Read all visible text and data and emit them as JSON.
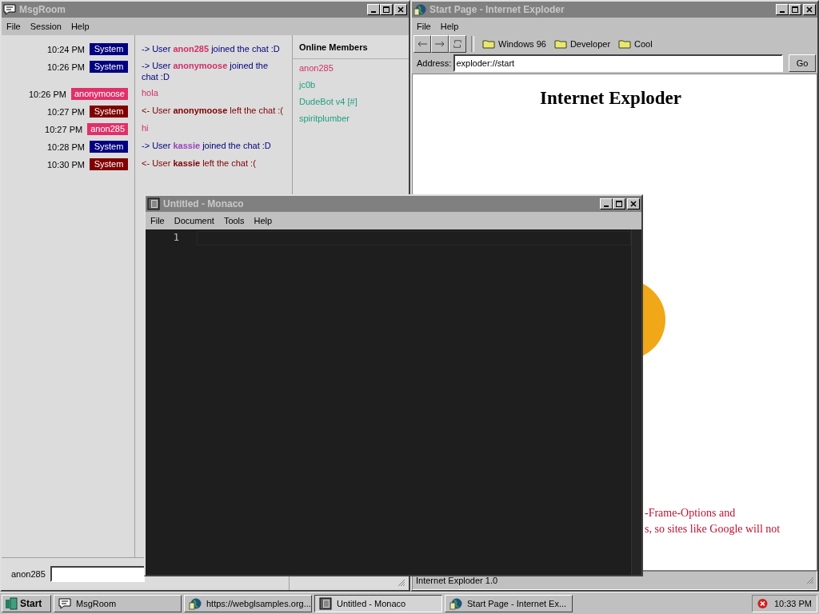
{
  "msgroom": {
    "title": "MsgRoom",
    "menu": [
      "File",
      "Session",
      "Help"
    ],
    "messages": [
      {
        "time": "10:24 PM",
        "sender": "System",
        "kind": "join",
        "before": "-> User ",
        "user": "anon285",
        "color": "#d0306a",
        "after": " joined the chat :D"
      },
      {
        "time": "10:26 PM",
        "sender": "System",
        "kind": "join",
        "before": "-> User ",
        "user": "anonymoose",
        "color": "#d0306a",
        "after": " joined the chat :D"
      },
      {
        "time": "10:26 PM",
        "sender": "anonymoose",
        "kind": "chat",
        "before": "hola"
      },
      {
        "time": "10:27 PM",
        "sender": "System",
        "kind": "leave",
        "before": "<- User ",
        "user": "anonymoose",
        "color": "#800000",
        "after": " left the chat :("
      },
      {
        "time": "10:27 PM",
        "sender": "anon285",
        "kind": "chat",
        "before": "hi"
      },
      {
        "time": "10:28 PM",
        "sender": "System",
        "kind": "join",
        "before": "-> User ",
        "user": "kassie",
        "color": "#9a40c0",
        "after": " joined the chat :D"
      },
      {
        "time": "10:30 PM",
        "sender": "System",
        "kind": "leave",
        "before": "<- User ",
        "user": "kassie",
        "color": "#800000",
        "after": " left the chat :("
      }
    ],
    "members_heading": "Online Members",
    "members": [
      {
        "name": "anon285",
        "color": "#d0306a"
      },
      {
        "name": "jc0b",
        "color": "#20a080"
      },
      {
        "name": "DudeBot v4 [#]",
        "color": "#20a080"
      },
      {
        "name": "spiritplumber",
        "color": "#20a080"
      }
    ],
    "input_label": "anon285"
  },
  "browser": {
    "title": "Start Page - Internet Exploder",
    "menu": [
      "File",
      "Help"
    ],
    "bookmarks": [
      "Windows 96",
      "Developer",
      "Cool"
    ],
    "address_label": "Address:",
    "address": "exploder://start",
    "go": "Go",
    "heading": "Internet Exploder",
    "notice_lines": [
      "-Frame-Options and",
      "s, so sites like Google will not"
    ],
    "status": "Internet Exploder 1.0"
  },
  "editor": {
    "title": "Untitled - Monaco",
    "menu": [
      "File",
      "Document",
      "Tools",
      "Help"
    ],
    "line_numbers": [
      "1"
    ]
  },
  "taskbar": {
    "start": "Start",
    "tasks": [
      {
        "label": "MsgRoom",
        "kind": "chat",
        "selected": false
      },
      {
        "label": "https://webglsamples.org...",
        "kind": "globe",
        "selected": false
      },
      {
        "label": "Untitled - Monaco",
        "kind": "notepad",
        "selected": true
      },
      {
        "label": "Start Page - Internet Ex...",
        "kind": "globe",
        "selected": false
      }
    ],
    "clock": "10:33 PM"
  }
}
